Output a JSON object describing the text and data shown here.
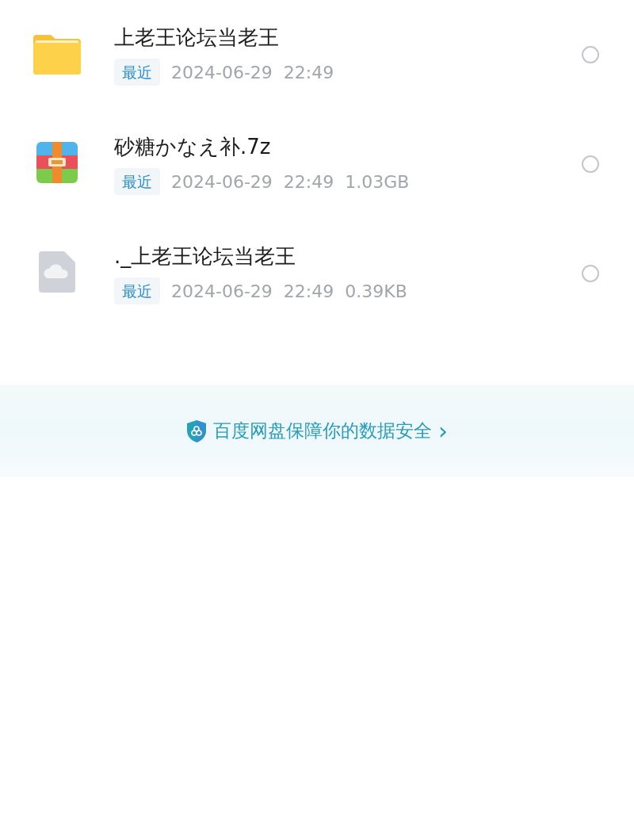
{
  "files": [
    {
      "kind": "folder",
      "name": "上老王论坛当老王",
      "tag": "最近",
      "date": "2024-06-29",
      "time": "22:49",
      "selected": false
    },
    {
      "kind": "archive",
      "name": "砂糖かなえ补.7z",
      "tag": "最近",
      "date": "2024-06-29",
      "time": "22:49",
      "size": "1.03GB",
      "selected": false
    },
    {
      "kind": "cloud",
      "name": "._上老王论坛当老王",
      "tag": "最近",
      "date": "2024-06-29",
      "time": "22:49",
      "size": "0.39KB",
      "selected": false
    }
  ],
  "security_banner": {
    "text": "百度网盘保障你的数据安全",
    "arrow": "›"
  }
}
